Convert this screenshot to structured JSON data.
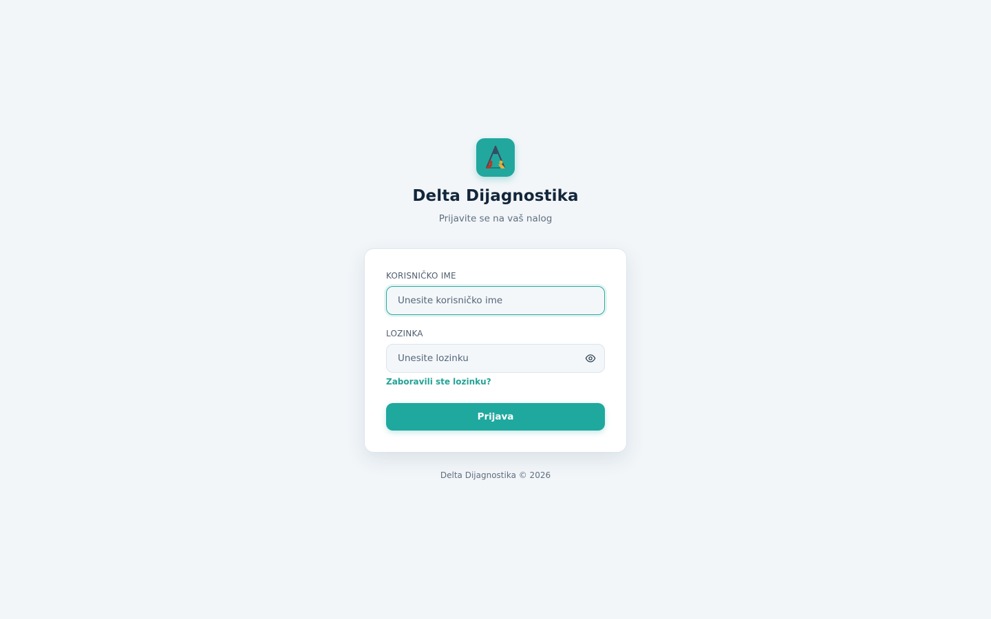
{
  "brand": {
    "title": "Delta Dijagnostika",
    "subtitle": "Prijavite se na vaš nalog",
    "logo_icon": "delta-triangle-logo-icon",
    "accent_color": "#1fa89e"
  },
  "form": {
    "username": {
      "label": "KORISNIČKO IME",
      "placeholder": "Unesite korisničko ime",
      "value": ""
    },
    "password": {
      "label": "LOZINKA",
      "placeholder": "Unesite lozinku",
      "value": "",
      "toggle_icon": "eye-icon"
    },
    "forgot_link": "Zaboravili ste lozinku?",
    "submit_label": "Prijava"
  },
  "footer": {
    "text": "Delta Dijagnostika © 2026"
  }
}
